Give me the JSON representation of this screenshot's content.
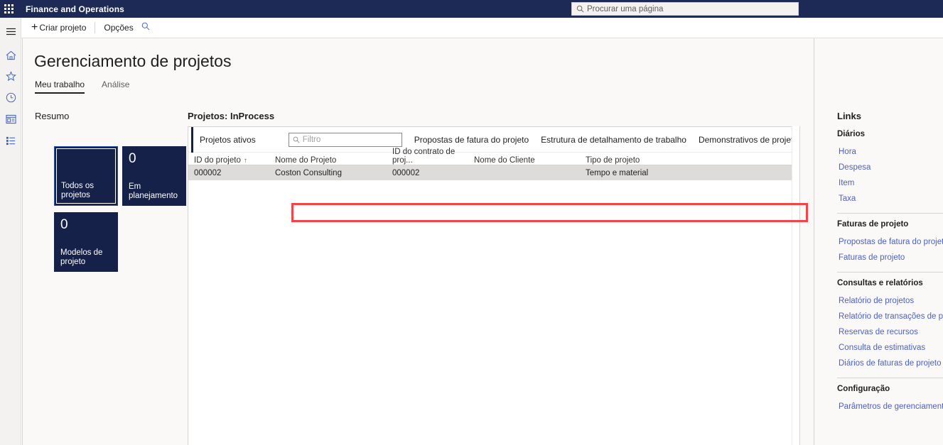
{
  "topbar": {
    "app_launcher_icon": "waffle-icon",
    "brand": "Finance and Operations",
    "search": {
      "icon": "search-icon",
      "placeholder": "Procurar uma página",
      "value": ""
    }
  },
  "commandbar": {
    "create_label": "Criar projeto",
    "options_label": "Opções",
    "search_icon": "search-icon"
  },
  "rail": {
    "hamburger_icon": "hamburger-icon",
    "items": [
      {
        "icon": "home-icon",
        "name": "home"
      },
      {
        "icon": "star-icon",
        "name": "favorites"
      },
      {
        "icon": "clock-icon",
        "name": "recent"
      },
      {
        "icon": "workspace-icon",
        "name": "workspaces"
      },
      {
        "icon": "list-icon",
        "name": "modules"
      }
    ]
  },
  "page": {
    "title": "Gerenciamento de projetos",
    "tabs": [
      {
        "label": "Meu trabalho",
        "active": true
      },
      {
        "label": "Análise",
        "active": false
      }
    ]
  },
  "summary": {
    "heading": "Resumo",
    "tiles": [
      {
        "count": "",
        "label": "Todos os projetos",
        "selected": true
      },
      {
        "count": "0",
        "label": "Em planejamento",
        "selected": false
      },
      {
        "count": "0",
        "label": "Modelos de projeto",
        "selected": false
      }
    ]
  },
  "list": {
    "heading": "Projetos: InProcess",
    "vertical_tab": "Projetos ativos",
    "filter": {
      "icon": "search-icon",
      "placeholder": "Filtro",
      "value": ""
    },
    "toolbar_links": [
      "Propostas de fatura do projeto",
      "Estrutura de detalhamento de trabalho",
      "Demonstrativos de projeto"
    ],
    "columns": [
      {
        "label": "ID do projeto",
        "sort": "↑"
      },
      {
        "label": "Nome do Projeto",
        "sort": ""
      },
      {
        "label": "ID do contrato de proj...",
        "sort": ""
      },
      {
        "label": "Nome do Cliente",
        "sort": ""
      },
      {
        "label": "Tipo de projeto",
        "sort": ""
      }
    ],
    "rows": [
      {
        "project_id": "000002",
        "project_name": "Coston Consulting",
        "contract_id": "000002",
        "customer_name": "",
        "project_type": "Tempo e material",
        "selected": true,
        "highlighted": true
      }
    ],
    "highlight_color": "#f4444a"
  },
  "links": {
    "title": "Links",
    "groups": [
      {
        "title": "Diários",
        "chevron": "chevron-up-icon",
        "items": [
          "Hora",
          "Despesa",
          "Item",
          "Taxa"
        ]
      },
      {
        "title": "Faturas de projeto",
        "chevron": "chevron-up-icon",
        "items": [
          "Propostas de fatura do projeto",
          "Faturas de projeto"
        ]
      },
      {
        "title": "Consultas e relatórios",
        "chevron": "chevron-up-icon",
        "items": [
          "Relatório de projetos",
          "Relatório de transações de projeto",
          "Reservas de recursos",
          "Consulta de estimativas",
          "Diários de faturas de projeto"
        ]
      },
      {
        "title": "Configuração",
        "chevron": "chevron-up-icon",
        "items": [
          "Parâmetros de gerenciamento e c..."
        ]
      }
    ]
  },
  "colors": {
    "brand_bar": "#1d2a56",
    "tile_bg": "#152148",
    "link_blue": "#4c5fc4",
    "grid_link_blue": "#3b5ec2",
    "canvas_bg": "#faf9f8",
    "selected_row": "#dedcda"
  }
}
